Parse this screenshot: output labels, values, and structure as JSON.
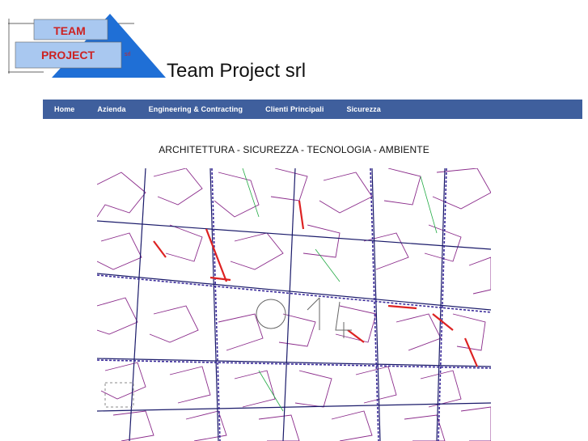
{
  "logo": {
    "line1": "TEAM",
    "line2": "PROJECT",
    "suffix": "srl",
    "colors": {
      "triangle": "#1f6fd6",
      "box": "#a9c8f0",
      "text": "#cc2222"
    }
  },
  "site_title": "Team Project srl",
  "nav": {
    "items": [
      {
        "label": "Home"
      },
      {
        "label": "Azienda"
      },
      {
        "label": "Engineering & Contracting"
      },
      {
        "label": "Clienti Principali"
      },
      {
        "label": "Sicurezza"
      }
    ],
    "bg_color": "#3f5f9d"
  },
  "tagline": "ARCHITETTURA - SICUREZZA - TECNOLOGIA - AMBIENTE",
  "map_image": {
    "colors": {
      "lines": "#7a1a7a",
      "roads": "#1a1a8a",
      "accent": "#dd2222",
      "green": "#22aa44"
    }
  }
}
